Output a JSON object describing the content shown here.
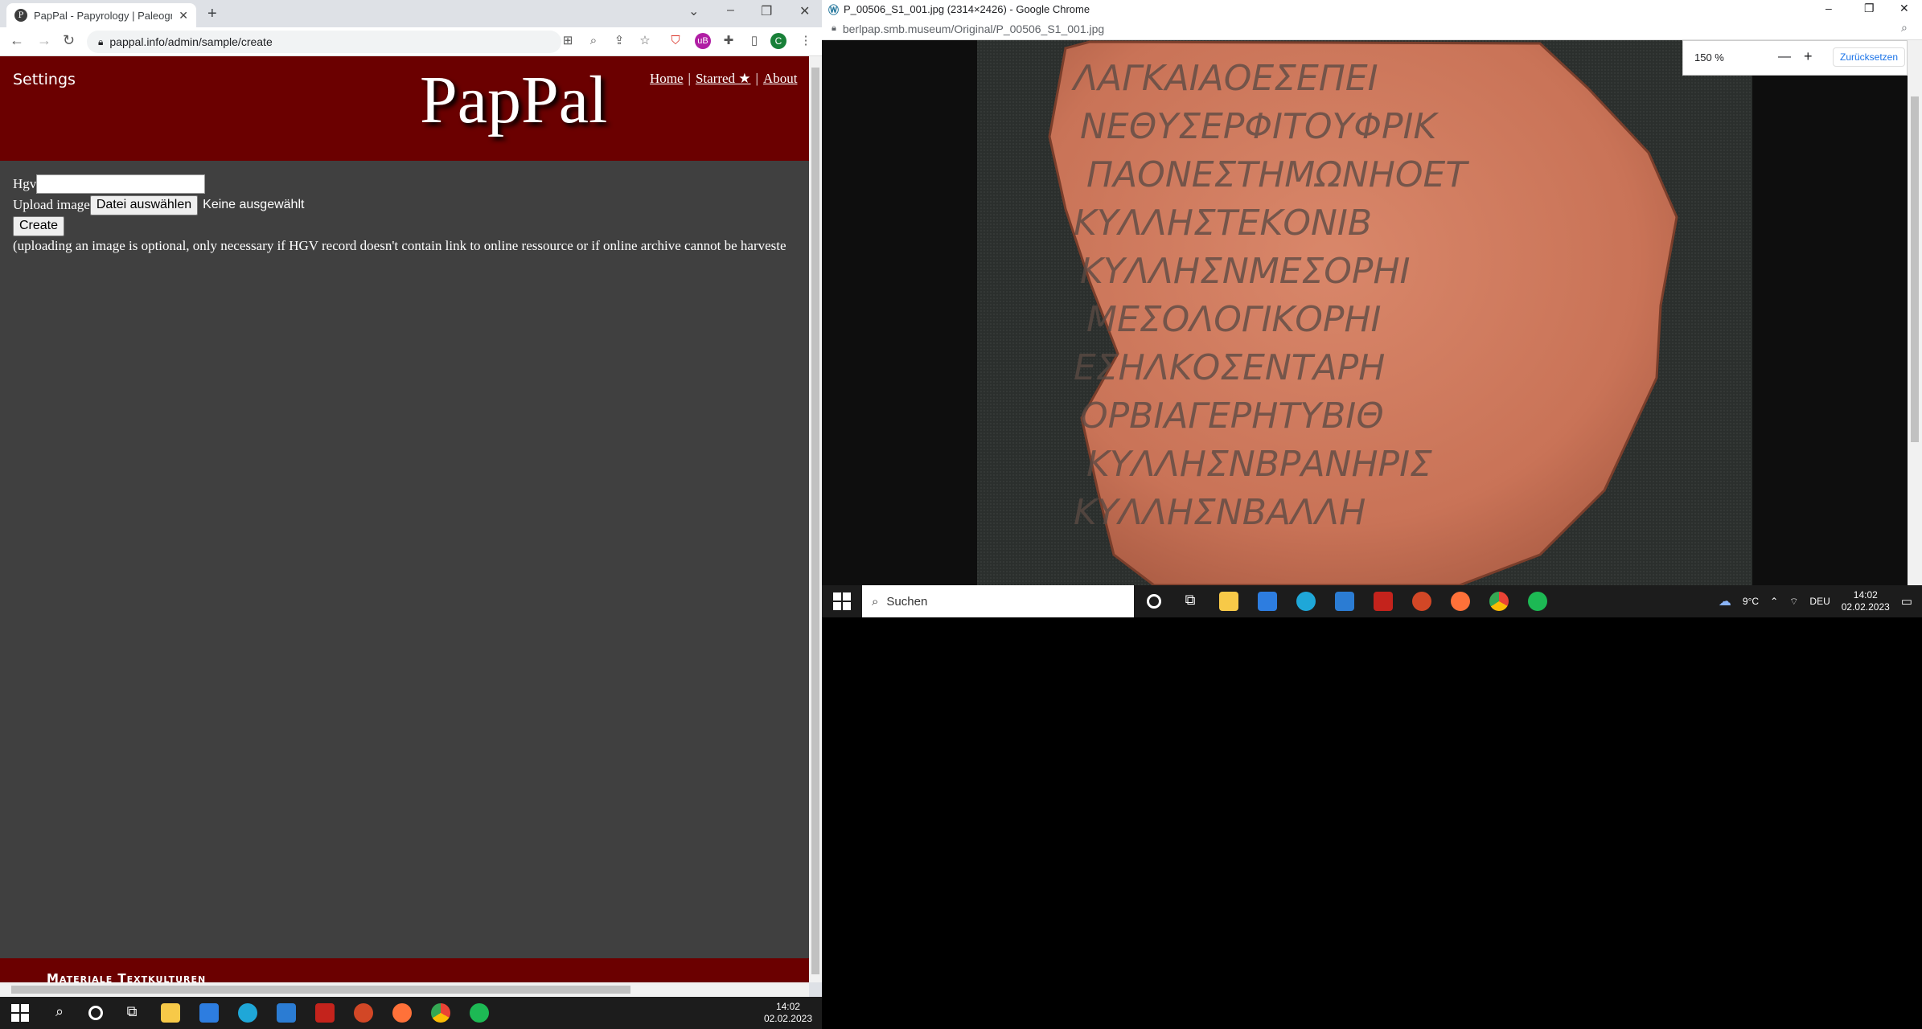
{
  "left_browser": {
    "tab_title": "PapPal - Papyrology | Paleograph",
    "url": "pappal.info/admin/sample/create",
    "profile_initial": "C",
    "ext_badge": "uB"
  },
  "site": {
    "settings_label": "Settings",
    "logo": "PapPal",
    "nav": {
      "home": "Home",
      "sep": "|",
      "starred": "Starred ★",
      "about": "About"
    },
    "form": {
      "hgv_label": "Hgv",
      "upload_label": "Upload image",
      "file_button": "Datei auswählen",
      "no_file": "Keine ausgewählt",
      "create_button": "Create",
      "note": "(uploading an image is optional, only necessary if HGV record doesn't contain link to online ressource or if online archive cannot be harveste"
    },
    "footer_text": "Materiale Textkulturen"
  },
  "right_browser": {
    "title": "P_00506_S1_001.jpg (2314×2426) - Google Chrome",
    "url": "berlpap.smb.museum/Original/P_00506_S1_001.jpg",
    "zoom_level": "150 %",
    "zoom_minus": "—",
    "zoom_plus": "+",
    "reset_button": "Zurücksetzen"
  },
  "ostracon_text": [
    "ΛΑΓΚΑΙΑΟΕΣΕΠΕΙ",
    "ΝΕΘΥΣΕΡΦΙΤΟΥΦΡΙΚ",
    "ΠΑΟΝΕΣΤΗΜΩΝΗΟΕΤ",
    "ΚΥΛΛΗΣΤΕΚΟΝΙΒ",
    "ΚΥΛΛΗΣΝΜΕΣΟΡΗΙ",
    "ΜΕΣΟΛΟΓΙΚΟΡΗΙ",
    "ΕΣΗΛΚΟΣΕΝΤΑΡΗ",
    "ΟΡΒΙΑΓΕΡΗΤΥΒΙΘ",
    "ΚΥΛΛΗΣΝΒΡΑΝΗΡΙΣ",
    "ΚΥΛΛΗΣΝΒΑΛΛΗ"
  ],
  "taskbar": {
    "search_placeholder": "Suchen",
    "weather": "9°C",
    "lang": "DEU",
    "time": "14:02",
    "date": "02.02.2023"
  },
  "colors": {
    "header_bg": "#6b0000",
    "page_bg": "#404040"
  }
}
